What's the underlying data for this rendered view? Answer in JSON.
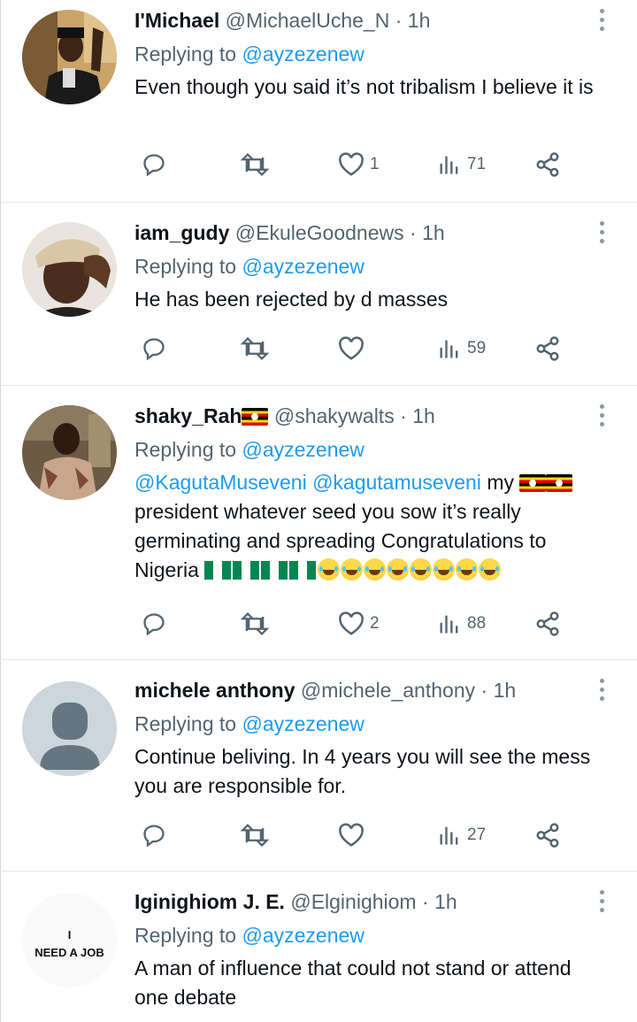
{
  "tweets": [
    {
      "name": "I'Michael",
      "handle": "@MichaelUche_N",
      "time": "1h",
      "replying_prefix": "Replying to",
      "replying_to": "@ayzezenew",
      "text": "Even though you said it’s not tribalism I believe it is",
      "likes": "1",
      "views": "71",
      "avatar": "photo-man-selfie"
    },
    {
      "name": "iam_gudy",
      "handle": "@EkuleGoodnews",
      "time": "1h",
      "replying_prefix": "Replying to",
      "replying_to": "@ayzezenew",
      "text": "He has been rejected by d masses",
      "likes": "",
      "views": "59",
      "avatar": "photo-man-cap"
    },
    {
      "name": "shaky_Rah",
      "handle": "@shakywalts",
      "time": "1h",
      "replying_prefix": "Replying to",
      "replying_to": "@ayzezenew",
      "text_mentions": "@KagutaMuseveni @kagutamuseveni",
      "text_my": "my",
      "text_body": "president whatever seed you sow it’s really germinating and spreading Congratulations to Nigeria",
      "likes": "2",
      "views": "88",
      "avatar": "photo-woman"
    },
    {
      "name": "michele anthony",
      "handle": "@michele_anthony",
      "time": "1h",
      "replying_prefix": "Replying to",
      "replying_to": "@ayzezenew",
      "text": "Continue beliving. In 4 years you will see the mess you are responsible for.",
      "likes": "",
      "views": "27",
      "avatar": "default-avatar"
    },
    {
      "name": "Iginighiom J. E.",
      "handle": "@Elginighiom",
      "time": "1h",
      "replying_prefix": "Replying to",
      "replying_to": "@ayzezenew",
      "text": "A man of influence that could not stand or attend one debate",
      "avatar_text_1": "I",
      "avatar_text_2": "NEED A JOB"
    }
  ],
  "colors": {
    "accent": "#1d9bf0",
    "muted": "#536471"
  },
  "icons": [
    "reply-icon",
    "retweet-icon",
    "like-icon",
    "views-icon",
    "share-icon",
    "more-icon"
  ]
}
